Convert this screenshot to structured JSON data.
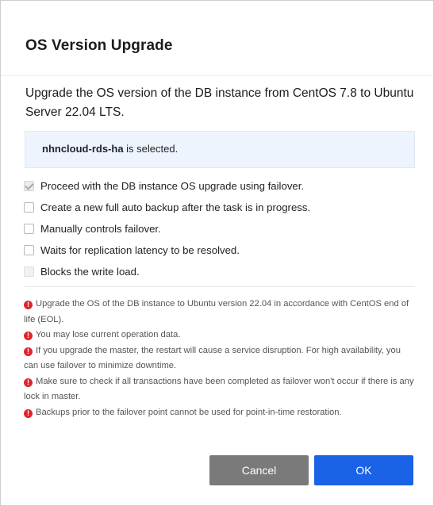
{
  "dialog": {
    "title": "OS Version Upgrade",
    "description": "Upgrade the OS version of the DB instance from CentOS 7.8 to Ubuntu Server 22.04 LTS.",
    "selection": {
      "instance": "nhncloud-rds-ha",
      "suffix": " is selected."
    },
    "options": [
      {
        "label": "Proceed with the DB instance OS upgrade using failover.",
        "checked": true,
        "disabled": true
      },
      {
        "label": "Create a new full auto backup after the task is in progress.",
        "checked": false,
        "disabled": false
      },
      {
        "label": "Manually controls failover.",
        "checked": false,
        "disabled": false
      },
      {
        "label": "Waits for replication latency to be resolved.",
        "checked": false,
        "disabled": false
      },
      {
        "label": "Blocks the write load.",
        "checked": false,
        "disabled": true
      }
    ],
    "warnings": [
      "Upgrade the OS of the DB instance to Ubuntu version 22.04 in accordance with CentOS end of life (EOL).",
      "You may lose current operation data.",
      "If you upgrade the master, the restart will cause a service disruption. For high availability, you can use failover to minimize downtime.",
      "Make sure to check if all transactions have been completed as failover won't occur if there is any lock in master.",
      "Backups prior to the failover point cannot be used for point-in-time restoration."
    ],
    "buttons": {
      "cancel": "Cancel",
      "ok": "OK"
    },
    "colors": {
      "primary": "#1a62e6",
      "secondary": "#7a7a7a",
      "warning": "#e0252a",
      "info_bg": "#eef4fd"
    }
  }
}
